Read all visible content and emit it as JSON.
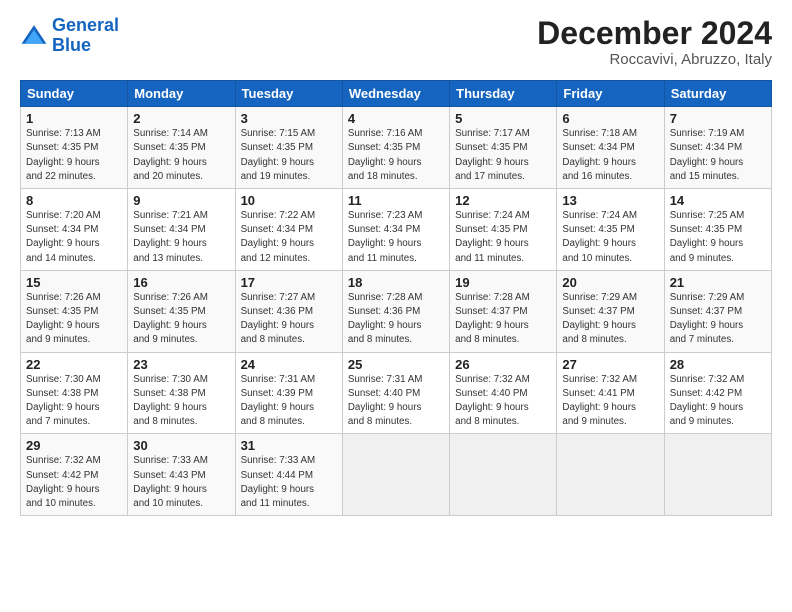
{
  "logo": {
    "line1": "General",
    "line2": "Blue"
  },
  "title": "December 2024",
  "subtitle": "Roccavivi, Abruzzo, Italy",
  "days_of_week": [
    "Sunday",
    "Monday",
    "Tuesday",
    "Wednesday",
    "Thursday",
    "Friday",
    "Saturday"
  ],
  "weeks": [
    [
      {
        "day": "1",
        "info": "Sunrise: 7:13 AM\nSunset: 4:35 PM\nDaylight: 9 hours\nand 22 minutes."
      },
      {
        "day": "2",
        "info": "Sunrise: 7:14 AM\nSunset: 4:35 PM\nDaylight: 9 hours\nand 20 minutes."
      },
      {
        "day": "3",
        "info": "Sunrise: 7:15 AM\nSunset: 4:35 PM\nDaylight: 9 hours\nand 19 minutes."
      },
      {
        "day": "4",
        "info": "Sunrise: 7:16 AM\nSunset: 4:35 PM\nDaylight: 9 hours\nand 18 minutes."
      },
      {
        "day": "5",
        "info": "Sunrise: 7:17 AM\nSunset: 4:35 PM\nDaylight: 9 hours\nand 17 minutes."
      },
      {
        "day": "6",
        "info": "Sunrise: 7:18 AM\nSunset: 4:34 PM\nDaylight: 9 hours\nand 16 minutes."
      },
      {
        "day": "7",
        "info": "Sunrise: 7:19 AM\nSunset: 4:34 PM\nDaylight: 9 hours\nand 15 minutes."
      }
    ],
    [
      {
        "day": "8",
        "info": "Sunrise: 7:20 AM\nSunset: 4:34 PM\nDaylight: 9 hours\nand 14 minutes."
      },
      {
        "day": "9",
        "info": "Sunrise: 7:21 AM\nSunset: 4:34 PM\nDaylight: 9 hours\nand 13 minutes."
      },
      {
        "day": "10",
        "info": "Sunrise: 7:22 AM\nSunset: 4:34 PM\nDaylight: 9 hours\nand 12 minutes."
      },
      {
        "day": "11",
        "info": "Sunrise: 7:23 AM\nSunset: 4:34 PM\nDaylight: 9 hours\nand 11 minutes."
      },
      {
        "day": "12",
        "info": "Sunrise: 7:24 AM\nSunset: 4:35 PM\nDaylight: 9 hours\nand 11 minutes."
      },
      {
        "day": "13",
        "info": "Sunrise: 7:24 AM\nSunset: 4:35 PM\nDaylight: 9 hours\nand 10 minutes."
      },
      {
        "day": "14",
        "info": "Sunrise: 7:25 AM\nSunset: 4:35 PM\nDaylight: 9 hours\nand 9 minutes."
      }
    ],
    [
      {
        "day": "15",
        "info": "Sunrise: 7:26 AM\nSunset: 4:35 PM\nDaylight: 9 hours\nand 9 minutes."
      },
      {
        "day": "16",
        "info": "Sunrise: 7:26 AM\nSunset: 4:35 PM\nDaylight: 9 hours\nand 9 minutes."
      },
      {
        "day": "17",
        "info": "Sunrise: 7:27 AM\nSunset: 4:36 PM\nDaylight: 9 hours\nand 8 minutes."
      },
      {
        "day": "18",
        "info": "Sunrise: 7:28 AM\nSunset: 4:36 PM\nDaylight: 9 hours\nand 8 minutes."
      },
      {
        "day": "19",
        "info": "Sunrise: 7:28 AM\nSunset: 4:37 PM\nDaylight: 9 hours\nand 8 minutes."
      },
      {
        "day": "20",
        "info": "Sunrise: 7:29 AM\nSunset: 4:37 PM\nDaylight: 9 hours\nand 8 minutes."
      },
      {
        "day": "21",
        "info": "Sunrise: 7:29 AM\nSunset: 4:37 PM\nDaylight: 9 hours\nand 7 minutes."
      }
    ],
    [
      {
        "day": "22",
        "info": "Sunrise: 7:30 AM\nSunset: 4:38 PM\nDaylight: 9 hours\nand 7 minutes."
      },
      {
        "day": "23",
        "info": "Sunrise: 7:30 AM\nSunset: 4:38 PM\nDaylight: 9 hours\nand 8 minutes."
      },
      {
        "day": "24",
        "info": "Sunrise: 7:31 AM\nSunset: 4:39 PM\nDaylight: 9 hours\nand 8 minutes."
      },
      {
        "day": "25",
        "info": "Sunrise: 7:31 AM\nSunset: 4:40 PM\nDaylight: 9 hours\nand 8 minutes."
      },
      {
        "day": "26",
        "info": "Sunrise: 7:32 AM\nSunset: 4:40 PM\nDaylight: 9 hours\nand 8 minutes."
      },
      {
        "day": "27",
        "info": "Sunrise: 7:32 AM\nSunset: 4:41 PM\nDaylight: 9 hours\nand 9 minutes."
      },
      {
        "day": "28",
        "info": "Sunrise: 7:32 AM\nSunset: 4:42 PM\nDaylight: 9 hours\nand 9 minutes."
      }
    ],
    [
      {
        "day": "29",
        "info": "Sunrise: 7:32 AM\nSunset: 4:42 PM\nDaylight: 9 hours\nand 10 minutes."
      },
      {
        "day": "30",
        "info": "Sunrise: 7:33 AM\nSunset: 4:43 PM\nDaylight: 9 hours\nand 10 minutes."
      },
      {
        "day": "31",
        "info": "Sunrise: 7:33 AM\nSunset: 4:44 PM\nDaylight: 9 hours\nand 11 minutes."
      },
      {
        "day": "",
        "info": ""
      },
      {
        "day": "",
        "info": ""
      },
      {
        "day": "",
        "info": ""
      },
      {
        "day": "",
        "info": ""
      }
    ]
  ]
}
